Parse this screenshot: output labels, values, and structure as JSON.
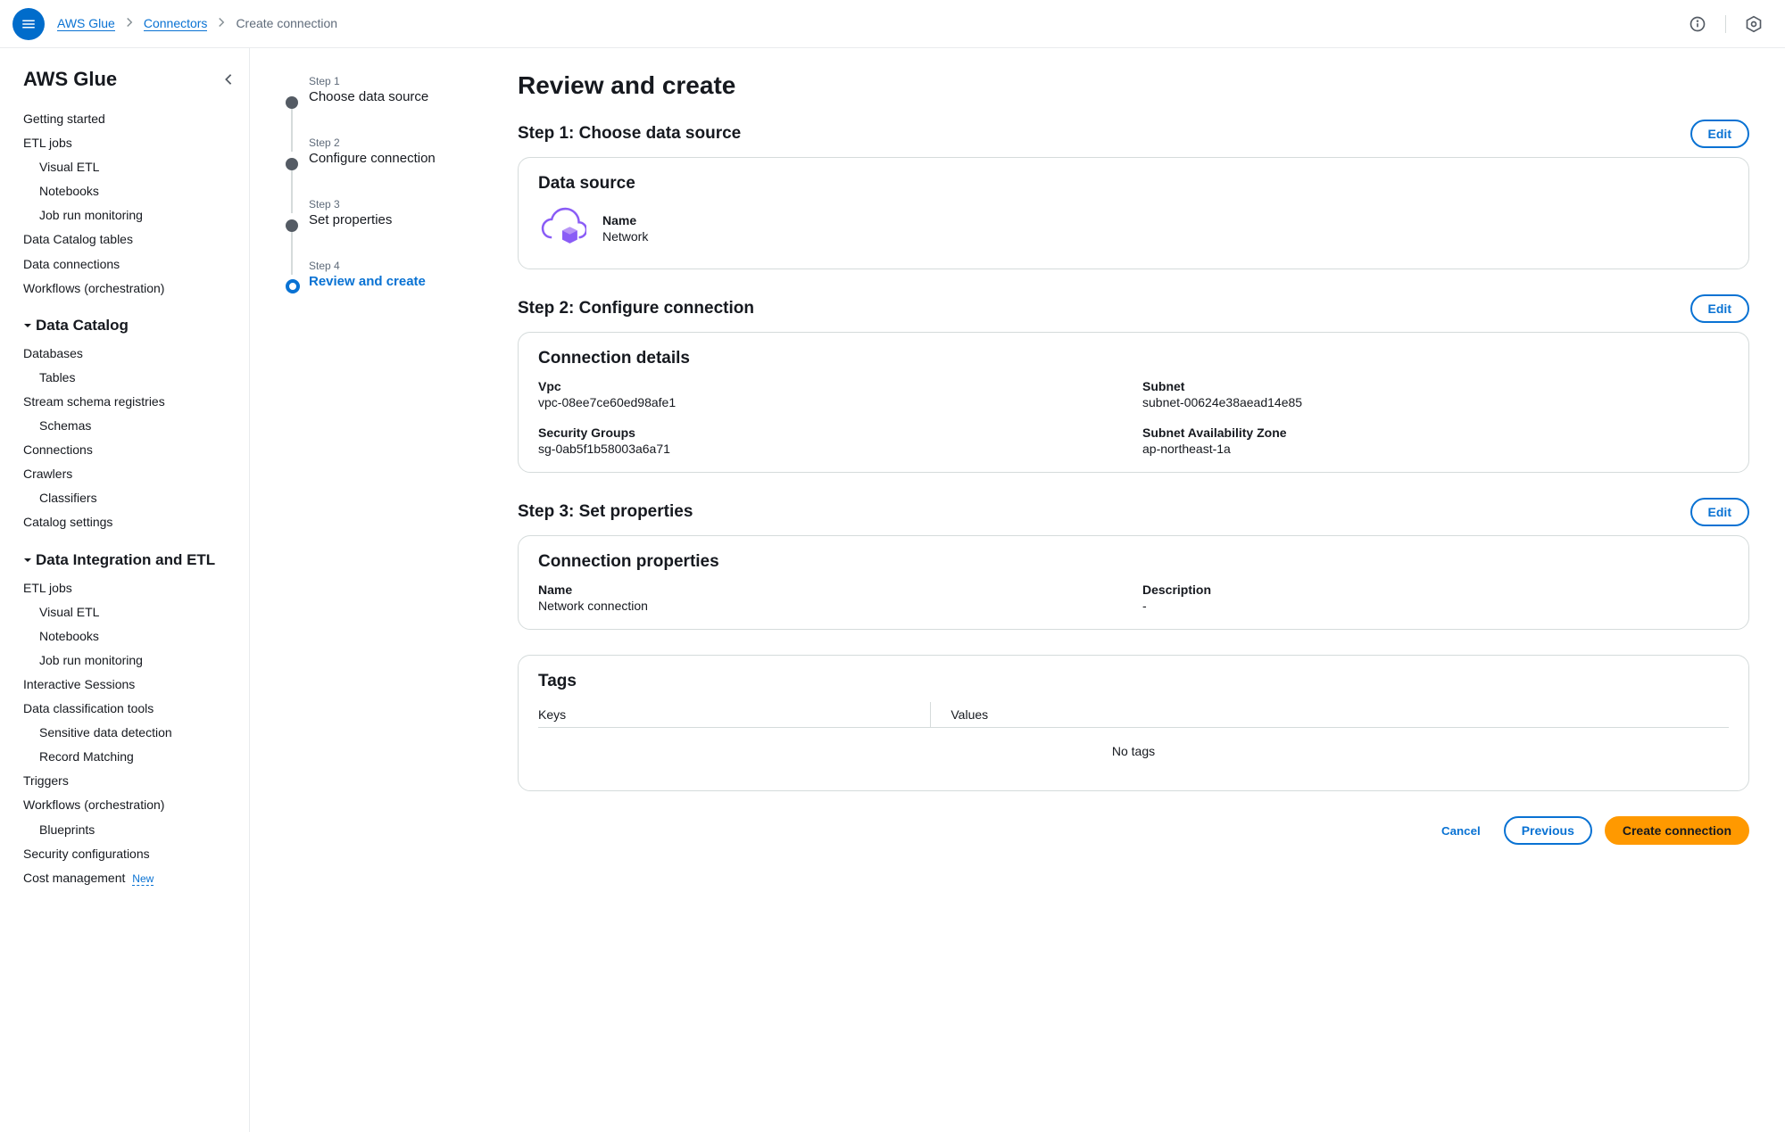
{
  "breadcrumb": {
    "items": [
      "AWS Glue",
      "Connectors",
      "Create connection"
    ]
  },
  "sidebar": {
    "title": "AWS Glue",
    "nav": {
      "getting_started": "Getting started",
      "etl_jobs": "ETL jobs",
      "visual_etl": "Visual ETL",
      "notebooks": "Notebooks",
      "job_run_monitoring": "Job run monitoring",
      "data_catalog_tables": "Data Catalog tables",
      "data_connections": "Data connections",
      "workflows_orch": "Workflows (orchestration)",
      "section_data_catalog": "Data Catalog",
      "databases": "Databases",
      "tables": "Tables",
      "stream_schema": "Stream schema registries",
      "schemas": "Schemas",
      "connections": "Connections",
      "crawlers": "Crawlers",
      "classifiers": "Classifiers",
      "catalog_settings": "Catalog settings",
      "section_di_etl": "Data Integration and ETL",
      "etl_jobs2": "ETL jobs",
      "visual_etl2": "Visual ETL",
      "notebooks2": "Notebooks",
      "job_run_monitoring2": "Job run monitoring",
      "interactive_sessions": "Interactive Sessions",
      "data_classification": "Data classification tools",
      "sensitive_data": "Sensitive data detection",
      "record_matching": "Record Matching",
      "triggers": "Triggers",
      "workflows_orch2": "Workflows (orchestration)",
      "blueprints": "Blueprints",
      "security_config": "Security configurations",
      "cost_management": "Cost management",
      "new_badge": "New"
    }
  },
  "stepper": {
    "step1_num": "Step 1",
    "step1_title": "Choose data source",
    "step2_num": "Step 2",
    "step2_title": "Configure connection",
    "step3_num": "Step 3",
    "step3_title": "Set properties",
    "step4_num": "Step 4",
    "step4_title": "Review and create"
  },
  "main": {
    "heading": "Review and create",
    "edit_label": "Edit",
    "step1": {
      "title": "Step 1: Choose data source",
      "card_title": "Data source",
      "name_label": "Name",
      "name_value": "Network"
    },
    "step2": {
      "title": "Step 2: Configure connection",
      "card_title": "Connection details",
      "vpc_label": "Vpc",
      "vpc_value": "vpc-08ee7ce60ed98afe1",
      "subnet_label": "Subnet",
      "subnet_value": "subnet-00624e38aead14e85",
      "sg_label": "Security Groups",
      "sg_value": "sg-0ab5f1b58003a6a71",
      "az_label": "Subnet Availability Zone",
      "az_value": "ap-northeast-1a"
    },
    "step3": {
      "title": "Step 3: Set properties",
      "card_title": "Connection properties",
      "name_label": "Name",
      "name_value": "Network connection",
      "desc_label": "Description",
      "desc_value": "-",
      "tags_title": "Tags",
      "keys_label": "Keys",
      "values_label": "Values",
      "no_tags": "No tags"
    },
    "footer": {
      "cancel": "Cancel",
      "previous": "Previous",
      "create": "Create connection"
    }
  }
}
